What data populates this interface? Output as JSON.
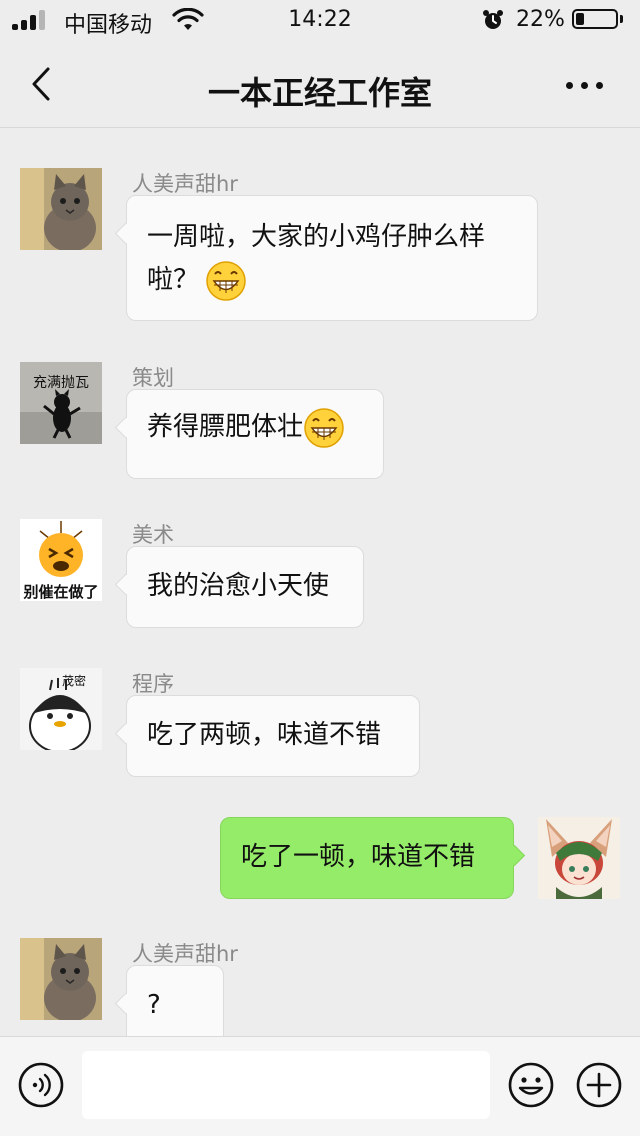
{
  "status_bar": {
    "carrier": "中国移动",
    "time": "14:22",
    "battery_percent": "22%",
    "battery_level": 0.22,
    "icons": [
      "signal-icon",
      "wifi-icon",
      "alarm-icon",
      "battery-icon"
    ]
  },
  "nav": {
    "title": "一本正经工作室",
    "back_icon": "chevron-left-icon",
    "more_icon": "more-icon"
  },
  "messages": [
    {
      "direction": "incoming",
      "sender": "人美声甜hr",
      "lines": [
        "一周啦，大家的小鸡仔肿么样",
        "啦？"
      ],
      "emoji": "grin-emoji",
      "avatar": "cat-avatar"
    },
    {
      "direction": "incoming",
      "sender": "策划",
      "lines": [
        "养得膘肥体壮"
      ],
      "emoji": "grin-emoji",
      "avatar": "black-cat-sticker-avatar",
      "avatar_text": "充满抛瓦"
    },
    {
      "direction": "incoming",
      "sender": "美术",
      "lines": [
        "我的治愈小天使"
      ],
      "emoji": null,
      "avatar": "stressed-emoji-avatar",
      "avatar_text": "别催在做了"
    },
    {
      "direction": "incoming",
      "sender": "程序",
      "lines": [
        "吃了两顿，味道不错"
      ],
      "emoji": null,
      "avatar": "penguin-sticker-avatar",
      "avatar_text": "茂密"
    },
    {
      "direction": "outgoing",
      "sender": "",
      "lines": [
        "吃了一顿，味道不错"
      ],
      "emoji": null,
      "avatar": "anime-fox-girl-avatar"
    },
    {
      "direction": "incoming",
      "sender": "人美声甜hr",
      "lines": [
        "?"
      ],
      "emoji": null,
      "avatar": "cat-avatar"
    }
  ],
  "input_bar": {
    "placeholder": "",
    "icons": [
      "voice-icon",
      "emoji-icon",
      "plus-icon"
    ]
  },
  "colors": {
    "background": "#ededed",
    "bubble_incoming": "#fafafa",
    "bubble_outgoing": "#95ec69"
  }
}
